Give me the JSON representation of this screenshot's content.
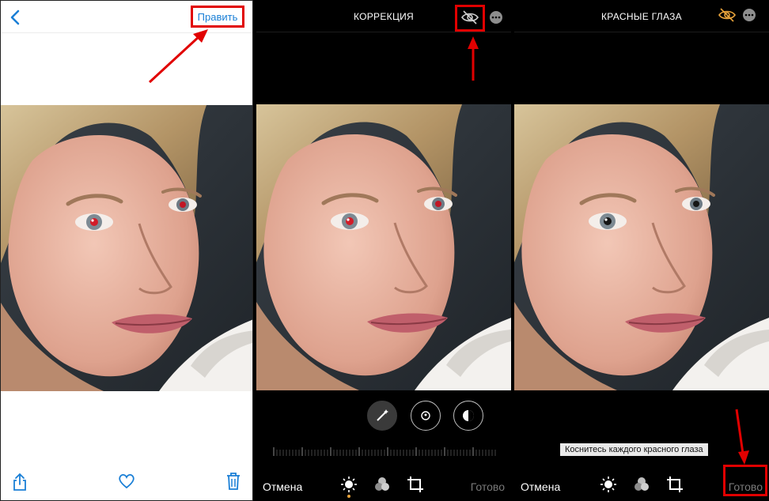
{
  "panel1": {
    "edit_label": "Править",
    "icons": [
      "chevron-left-icon",
      "share-icon",
      "heart-icon",
      "trash-icon"
    ]
  },
  "panel2": {
    "title": "КОРРЕКЦИЯ",
    "cancel_label": "Отмена",
    "done_label": "Готово",
    "icons": [
      "red-eye-icon",
      "more-icon",
      "magic-wand-icon",
      "portrait-icon",
      "filter-icon",
      "adjust-icon",
      "filters-icon",
      "crop-icon"
    ]
  },
  "panel3": {
    "title": "КРАСНЫЕ ГЛАЗА",
    "tooltip": "Коснитесь каждого красного глаза",
    "cancel_label": "Отмена",
    "done_label": "Готово",
    "icons": [
      "red-eye-icon",
      "more-icon",
      "adjust-icon",
      "filters-icon",
      "crop-icon"
    ]
  },
  "colors": {
    "accent": "#1a7fd6",
    "highlight": "#e10000",
    "active": "#e8a33b"
  }
}
